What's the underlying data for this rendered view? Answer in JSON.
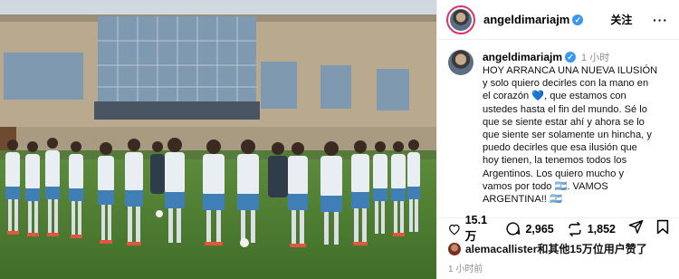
{
  "post": {
    "username": "angeldimariajm",
    "follow_label": "关注",
    "more_label": "···",
    "time_ago": "1 小时",
    "caption": "HOY ARRANCA UNA NUEVA ILUSIÓN\ny solo quiero decirles con la mano en\nel corazón 💙, que estamos con\nustedes hasta el fin del mundo. Sé lo\nque se siente estar ahí y ahora se lo\nque siente ser solamente un hincha, y\npuedo decirles que esa ilusión que\nhoy tienen, la tenemos todos los\nArgentinos. Los quiero mucho y\nvamos por todo 🇦🇷. VAMOS\nARGENTINA!! 🇦🇷",
    "likes_count": "15.1 万",
    "comments_count": "2,965",
    "reposts_count": "1,852",
    "liked_by_text": "alemacallister和其他15万位用户赞了",
    "date_text": "1 小时前"
  },
  "icons": {
    "verified": "verified-badge-icon",
    "heart": "heart-icon",
    "comment": "comment-icon",
    "repost": "repost-icon",
    "share": "share-icon",
    "bookmark": "bookmark-icon"
  },
  "colors": {
    "verified": "#3897f0",
    "muted": "#8e8e8e",
    "story_ring": "#e1306c"
  }
}
